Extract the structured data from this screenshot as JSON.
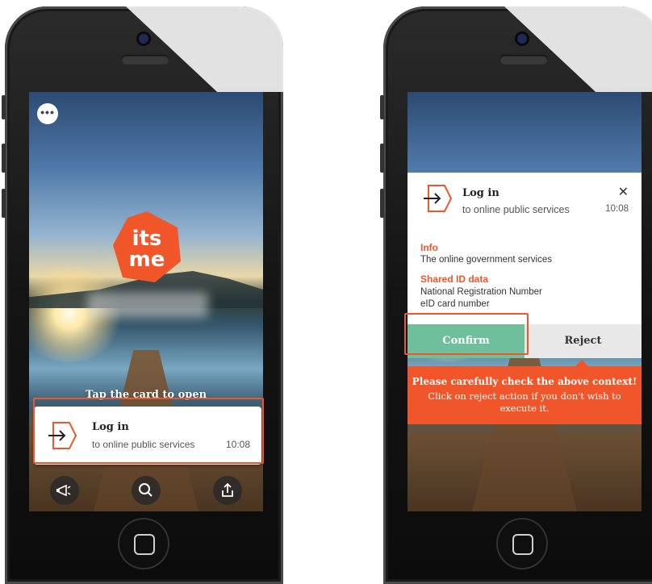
{
  "left_screen": {
    "menu_label": "•••",
    "logo_text_top": "its",
    "logo_text_bottom": "me",
    "tap_hint": "Tap the card to open",
    "card": {
      "title": "Log in",
      "subtitle": "to online public services",
      "time": "10:08"
    },
    "bottom_icons": [
      "megaphone-icon",
      "search-icon",
      "share-icon"
    ]
  },
  "right_screen": {
    "dialog": {
      "title": "Log in",
      "subtitle": "to online public services",
      "time": "10:08",
      "close_label": "✕",
      "info_heading": "Info",
      "info_text": "The online government services",
      "shared_heading": "Shared ID data",
      "shared_items": [
        "National Registration Number",
        "eID card number"
      ],
      "confirm_label": "Confirm",
      "reject_label": "Reject"
    },
    "warning": {
      "title": "Please carefully check the above context!",
      "text": "Click on reject action if you don't wish to execute it."
    }
  },
  "colors": {
    "brand_orange": "#f0562a",
    "confirm_green": "#6fbf9c",
    "reject_gray": "#e8e8e8"
  }
}
